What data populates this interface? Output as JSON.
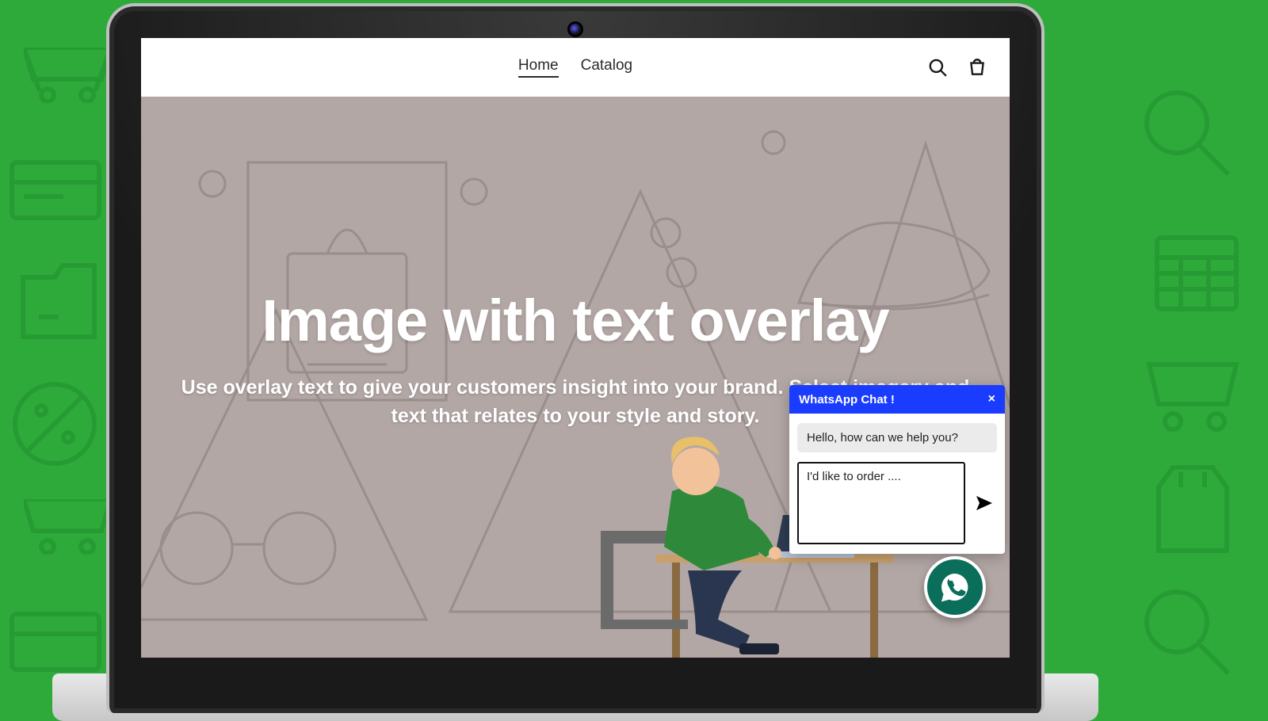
{
  "header": {
    "nav": [
      {
        "label": "Home",
        "active": true
      },
      {
        "label": "Catalog",
        "active": false
      }
    ]
  },
  "hero": {
    "title": "Image with text overlay",
    "subtitle": "Use overlay text to give your customers insight into your brand. Select imagery and text that relates to your style and story."
  },
  "chat": {
    "title": "WhatsApp Chat !",
    "close_symbol": "×",
    "greeting": "Hello, how can we help you?",
    "input_value": "I'd like to order ...."
  }
}
